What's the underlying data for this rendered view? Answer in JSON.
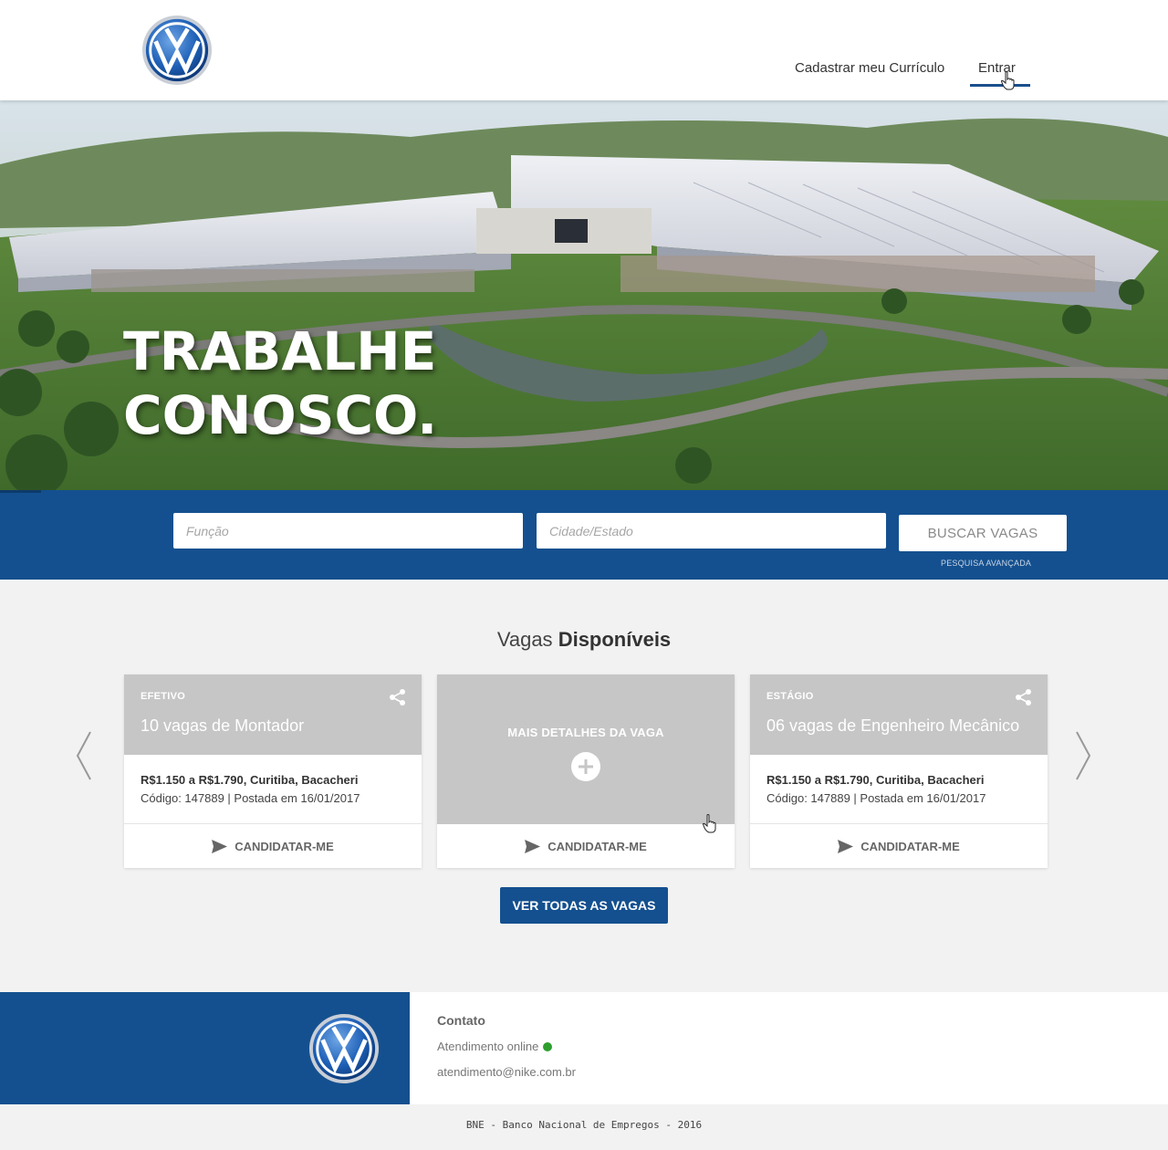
{
  "header": {
    "logo": "volkswagen-logo",
    "nav": {
      "cadastrar": "Cadastrar meu Currículo",
      "entrar": "Entrar"
    }
  },
  "hero": {
    "title_line1": "TRABALHE",
    "title_line2": "CONOSCO."
  },
  "search": {
    "funcao_placeholder": "Função",
    "cidade_placeholder": "Cidade/Estado",
    "button_label": "BUSCAR VAGAS",
    "advanced_link": "PESQUISA AVANÇADA"
  },
  "vagas": {
    "title_regular": "Vagas",
    "title_bold": "Disponíveis",
    "cards": [
      {
        "type": "EFETIVO",
        "title": "10 vagas de Montador",
        "salary": "R$1.150 a R$1.790, Curitiba, Bacacheri",
        "code": "Código: 147889 | Postada em 16/01/2017",
        "apply_label": "CANDIDATAR-ME"
      },
      {
        "detail_label": "MAIS DETALHES DA VAGA",
        "apply_label": "CANDIDATAR-ME"
      },
      {
        "type": "ESTÁGIO",
        "title": "06 vagas de Engenheiro Mecânico",
        "salary": "R$1.150 a R$1.790, Curitiba, Bacacheri",
        "code": "Código: 147889 | Postada em 16/01/2017",
        "apply_label": "CANDIDATAR-ME"
      }
    ],
    "see_all_label": "VER TODAS AS VAGAS"
  },
  "footer": {
    "contact_title": "Contato",
    "online_label": "Atendimento online",
    "email": "atendimento@nike.com.br",
    "copyright": "BNE - Banco Nacional de Empregos - 2016"
  },
  "colors": {
    "primary_blue": "#14508f",
    "card_header_gray": "#c6c6c6",
    "online_green": "#2e9e2e"
  }
}
